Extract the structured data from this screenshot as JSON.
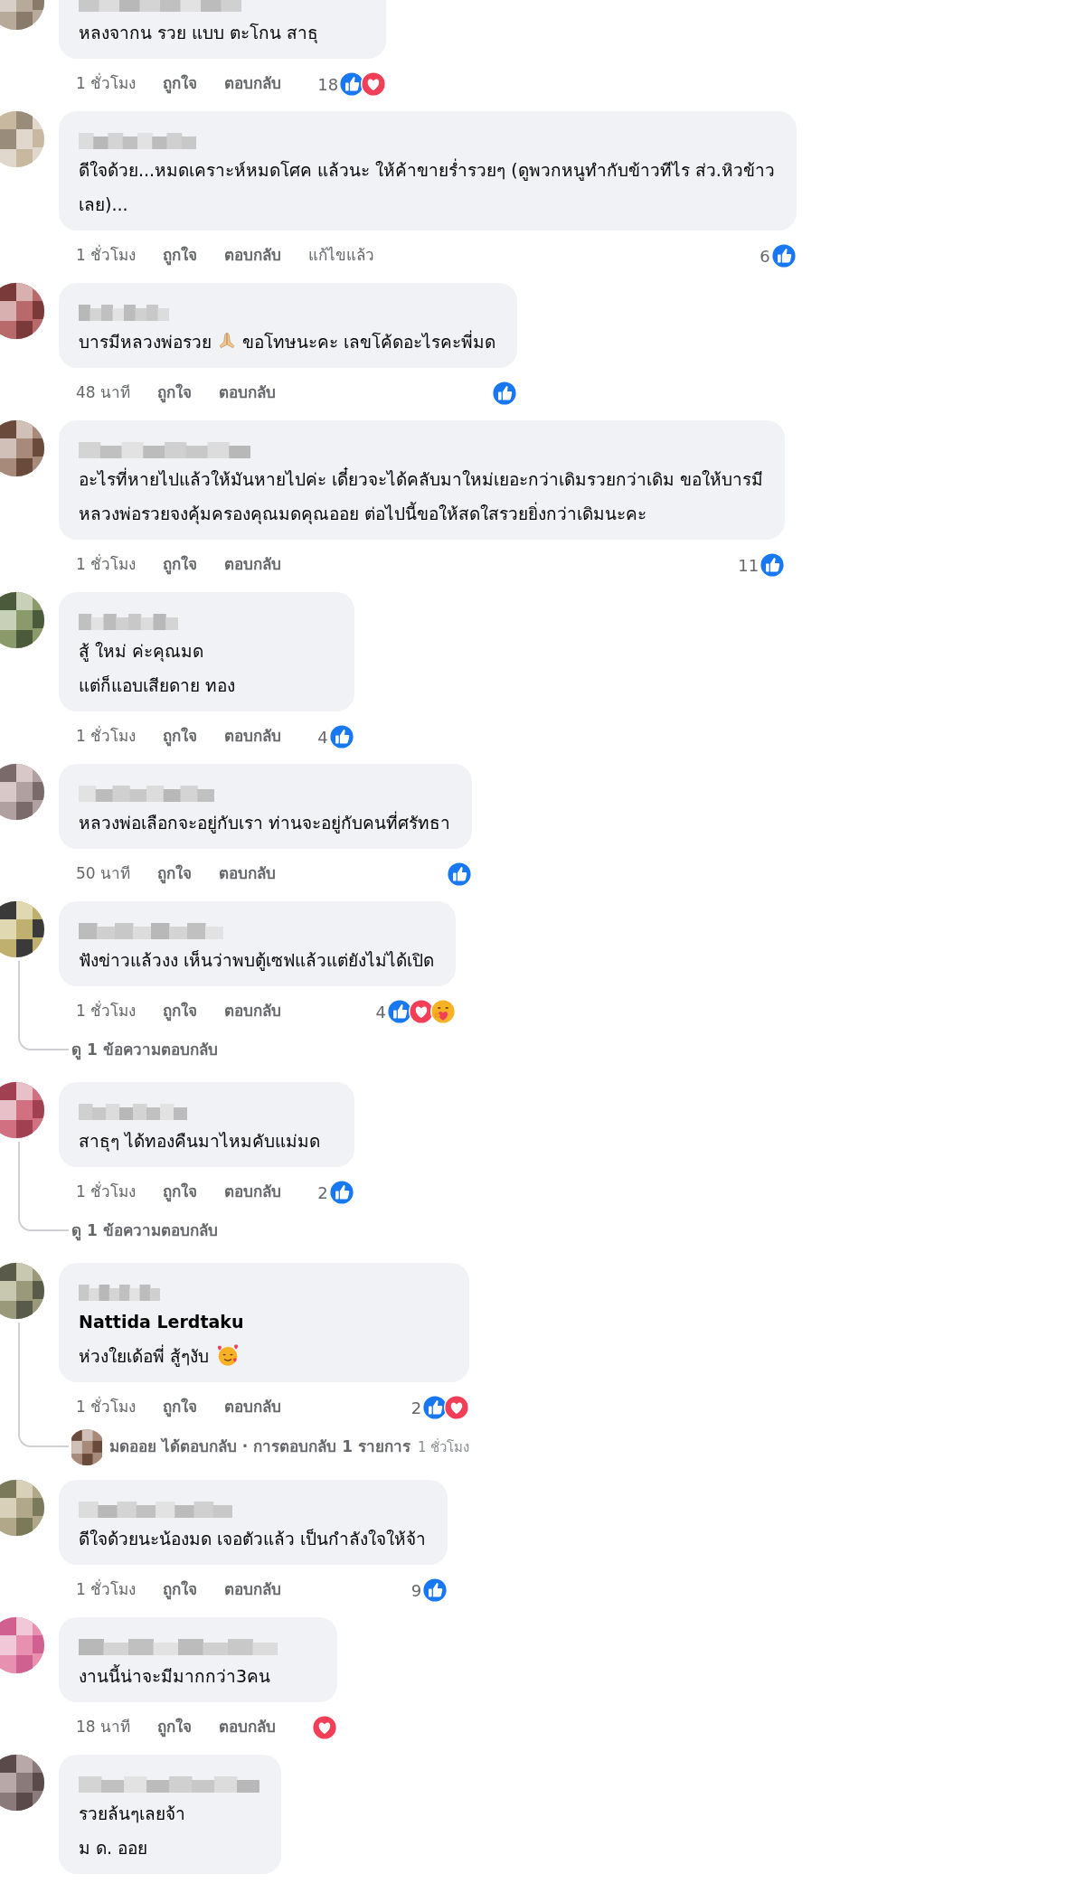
{
  "comments": [
    {
      "body": [
        {
          "kind": "text",
          "text": "หลงจากน รวย แบบ ตะโกน สาธุ"
        }
      ],
      "time": "1 ชั่วโมง",
      "like_label": "ถูกใจ",
      "reply_label": "ตอบกลับ",
      "reaction_count": "18",
      "reactions": [
        {
          "kind": "like"
        },
        {
          "kind": "love"
        }
      ]
    },
    {
      "body": [
        {
          "kind": "text",
          "text": "ดีใจด้วย...หมดเคราะห์หมดโศค แล้วนะ ให้ค้าขายร่ำรวยๆ (ดูพวกหนูทำกับข้าวทีไร ส่ว.หิวข้าว\nเลย)..."
        }
      ],
      "time": "1 ชั่วโมง",
      "like_label": "ถูกใจ",
      "reply_label": "ตอบกลับ",
      "edited": "แก้ไขแล้ว",
      "reaction_count": "6",
      "reactions": [
        {
          "kind": "like"
        }
      ]
    },
    {
      "body": [
        {
          "kind": "text",
          "text": "บารมีหลวงพ่อรวย"
        },
        {
          "kind": "pray"
        },
        {
          "kind": "text",
          "text": "ขอโทษนะคะ เลขโค้ดอะไรคะพี่มด"
        }
      ],
      "time": "48 นาที",
      "like_label": "ถูกใจ",
      "reply_label": "ตอบกลับ",
      "reactions": [
        {
          "kind": "like"
        }
      ]
    },
    {
      "body": [
        {
          "kind": "text",
          "text": "อะไรที่หายไปแล้วให้มันหายไปค่ะ เดี๋ยวจะได้คลับมาใหม่เยอะกว่าเดิมรวยกว่าเดิม ขอให้บารมี\nหลวงพ่อรวยจงคุ้มครองคุณมดคุณออย ต่อไปนี้ขอให้สดใสรวยยิ่งกว่าเดิมนะคะ"
        }
      ],
      "time": "1 ชั่วโมง",
      "like_label": "ถูกใจ",
      "reply_label": "ตอบกลับ",
      "reaction_count": "11",
      "reactions": [
        {
          "kind": "like"
        }
      ]
    },
    {
      "body": [
        {
          "kind": "text",
          "text": "สู้ ใหม่ ค่ะคุณมด\nแต่ก็แอบเสียดาย ทอง"
        }
      ],
      "time": "1 ชั่วโมง",
      "like_label": "ถูกใจ",
      "reply_label": "ตอบกลับ",
      "reaction_count": "4",
      "reactions": [
        {
          "kind": "like"
        }
      ]
    },
    {
      "body": [
        {
          "kind": "text",
          "text": "หลวงพ่อเลือกจะอยู่กับเรา ท่านจะอยู่กับคนที่ศรัทธา"
        }
      ],
      "time": "50 นาที",
      "like_label": "ถูกใจ",
      "reply_label": "ตอบกลับ",
      "reactions": [
        {
          "kind": "like"
        }
      ]
    },
    {
      "body": [
        {
          "kind": "text",
          "text": "ฟังข่าวแล้วงง เห็นว่าพบตู้เซฟแล้วแต่ยังไม่ได้เปิด"
        }
      ],
      "time": "1 ชั่วโมง",
      "like_label": "ถูกใจ",
      "reply_label": "ตอบกลับ",
      "reaction_count": "4",
      "reactions": [
        {
          "kind": "like"
        },
        {
          "kind": "love"
        },
        {
          "kind": "care"
        }
      ],
      "view_replies": "ดู 1 ข้อความตอบกลับ"
    },
    {
      "body": [
        {
          "kind": "text",
          "text": "สาธุๆ ได้ทองคืนมาไหมคับแม่มด"
        }
      ],
      "time": "1 ชั่วโมง",
      "like_label": "ถูกใจ",
      "reply_label": "ตอบกลับ",
      "reaction_count": "2",
      "reactions": [
        {
          "kind": "like"
        }
      ],
      "view_replies": "ดู 1 ข้อความตอบกลับ"
    },
    {
      "tag": "Nattida Lerdtaku",
      "body": [
        {
          "kind": "text",
          "text": "ห่วงใยเด้อพี่ สู้ๆงับ"
        },
        {
          "kind": "hearts"
        }
      ],
      "time": "1 ชั่วโมง",
      "like_label": "ถูกใจ",
      "reply_label": "ตอบกลับ",
      "reaction_count": "2",
      "reactions": [
        {
          "kind": "like"
        },
        {
          "kind": "love"
        }
      ],
      "reply_summary": {
        "text": "มดออย ได้ตอบกลับ · การตอบกลับ 1 รายการ",
        "time": "1 ชั่วโมง"
      }
    },
    {
      "body": [
        {
          "kind": "text",
          "text": "ดีใจด้วยนะน้องมด เจอตัวแล้ว เป็นกำลังใจให้จ้า"
        }
      ],
      "time": "1 ชั่วโมง",
      "like_label": "ถูกใจ",
      "reply_label": "ตอบกลับ",
      "reaction_count": "9",
      "reactions": [
        {
          "kind": "like"
        }
      ]
    },
    {
      "body": [
        {
          "kind": "text",
          "text": "งานนี้น่าจะมีมากกว่า3คน"
        }
      ],
      "time": "18 นาที",
      "like_label": "ถูกใจ",
      "reply_label": "ตอบกลับ",
      "reactions": [
        {
          "kind": "love"
        }
      ]
    },
    {
      "body": [
        {
          "kind": "text",
          "text": "รวยล้นๆเลยจ้า\nม ด. ออย"
        }
      ]
    }
  ]
}
